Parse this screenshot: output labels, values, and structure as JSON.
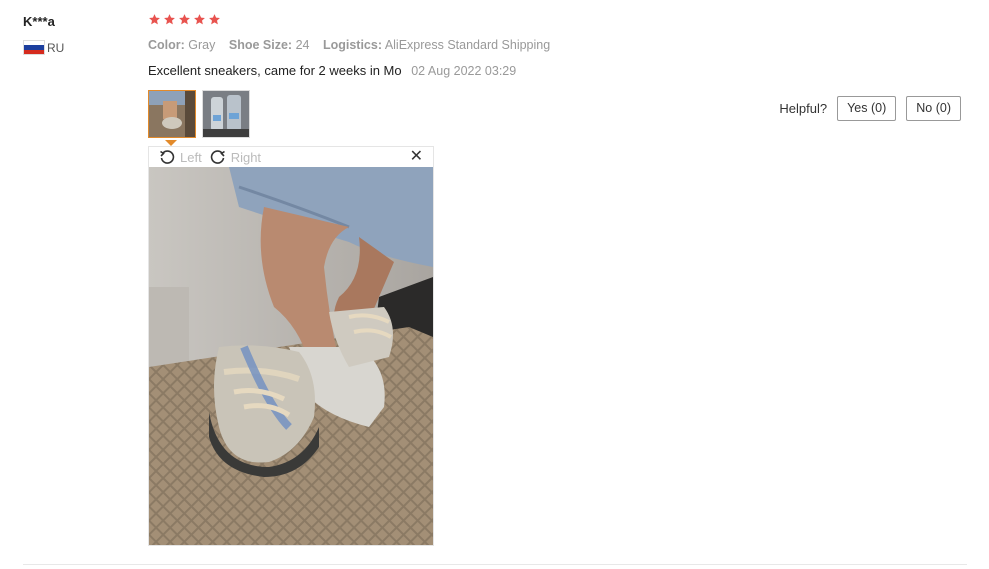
{
  "review": {
    "user_name": "K***a",
    "country_code": "RU",
    "rating": 5,
    "rating_color": "#e8534f",
    "sku": {
      "color_label": "Color:",
      "color_value": "Gray",
      "size_label": "Shoe Size:",
      "size_value": "24",
      "logistics_label": "Logistics:",
      "logistics_value": "AliExpress Standard Shipping"
    },
    "text": "Excellent sneakers, came for 2 weeks in Mo",
    "date": "02 Aug 2022 03:29",
    "images": [
      {
        "name": "review-photo-1",
        "active": true
      },
      {
        "name": "review-photo-2",
        "active": false
      }
    ],
    "viewer": {
      "rotate_left_label": "Left",
      "rotate_right_label": "Right",
      "close_icon": "close-icon",
      "close_glyph": "✕"
    },
    "helpful": {
      "label": "Helpful?",
      "yes_label": "Yes (0)",
      "no_label": "No (0)"
    }
  },
  "colors": {
    "accent": "#e28a2b",
    "muted_text": "#999999",
    "star": "#e8534f"
  }
}
